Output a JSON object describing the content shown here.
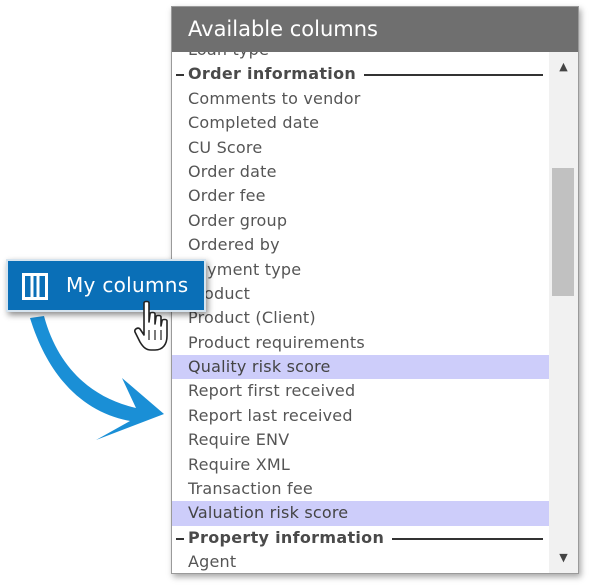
{
  "panel": {
    "title": "Available columns",
    "scrollbar": {
      "up_icon": "arrow-up-icon",
      "down_icon": "arrow-down-icon"
    },
    "items": [
      {
        "type": "item",
        "label": "Loan type",
        "selected": false
      },
      {
        "type": "group",
        "label": "Order information"
      },
      {
        "type": "item",
        "label": "Comments to vendor",
        "selected": false
      },
      {
        "type": "item",
        "label": "Completed date",
        "selected": false
      },
      {
        "type": "item",
        "label": "CU Score",
        "selected": false
      },
      {
        "type": "item",
        "label": "Order date",
        "selected": false
      },
      {
        "type": "item",
        "label": "Order fee",
        "selected": false
      },
      {
        "type": "item",
        "label": "Order group",
        "selected": false
      },
      {
        "type": "item",
        "label": "Ordered by",
        "selected": false
      },
      {
        "type": "item",
        "label": "Payment type",
        "selected": false
      },
      {
        "type": "item",
        "label": "Product",
        "selected": false
      },
      {
        "type": "item",
        "label": "Product (Client)",
        "selected": false
      },
      {
        "type": "item",
        "label": "Product requirements",
        "selected": false
      },
      {
        "type": "item",
        "label": "Quality risk score",
        "selected": true
      },
      {
        "type": "item",
        "label": "Report first received",
        "selected": false
      },
      {
        "type": "item",
        "label": "Report last received",
        "selected": false
      },
      {
        "type": "item",
        "label": "Require ENV",
        "selected": false
      },
      {
        "type": "item",
        "label": "Require XML",
        "selected": false
      },
      {
        "type": "item",
        "label": "Transaction fee",
        "selected": false
      },
      {
        "type": "item",
        "label": "Valuation risk score",
        "selected": true
      },
      {
        "type": "group",
        "label": "Property information"
      },
      {
        "type": "item",
        "label": "Agent",
        "selected": false
      }
    ]
  },
  "my_columns_button": {
    "label": "My columns",
    "icon": "columns-icon"
  },
  "overlay": {
    "arrow_icon": "curved-arrow-icon",
    "cursor_icon": "hand-pointer-icon"
  },
  "colors": {
    "header_bg": "#6f6f6f",
    "selected_bg": "#cdcdfa",
    "button_bg": "#0a6fb7",
    "arrow": "#1a8fd6"
  }
}
